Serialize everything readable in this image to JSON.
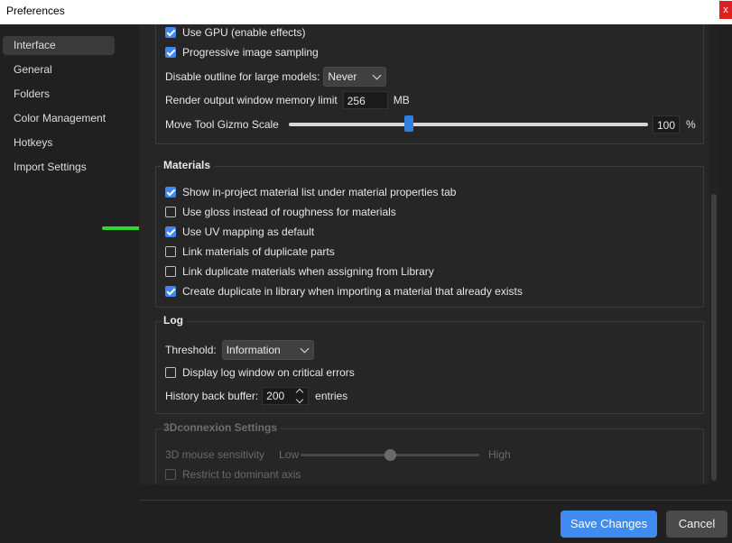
{
  "window": {
    "title": "Preferences",
    "close_glyph": "x"
  },
  "sidebar": {
    "items": [
      {
        "label": "Interface",
        "active": true
      },
      {
        "label": "General"
      },
      {
        "label": "Folders"
      },
      {
        "label": "Color Management"
      },
      {
        "label": "Hotkeys"
      },
      {
        "label": "Import Settings"
      }
    ]
  },
  "interface": {
    "use_gpu_label": "Use GPU (enable effects)",
    "progressive_label": "Progressive image sampling",
    "disable_outline_label": "Disable outline for large models:",
    "disable_outline_value": "Never",
    "render_memory_label": "Render output window memory limit",
    "render_memory_value": "256",
    "render_memory_unit": "MB",
    "gizmo_label": "Move Tool Gizmo Scale",
    "gizmo_value": "100",
    "gizmo_unit": "%",
    "gizmo_fraction": 0.335
  },
  "materials": {
    "title": "Materials",
    "options": [
      {
        "label": "Show in-project material list under material properties tab",
        "checked": true
      },
      {
        "label": "Use gloss instead of roughness for materials",
        "checked": false
      },
      {
        "label": "Use UV mapping as default",
        "checked": true
      },
      {
        "label": "Link materials of duplicate parts",
        "checked": false
      },
      {
        "label": "Link duplicate materials when assigning from Library",
        "checked": false
      },
      {
        "label": "Create duplicate in library when importing a material that already exists",
        "checked": true
      }
    ]
  },
  "log": {
    "title": "Log",
    "threshold_label": "Threshold:",
    "threshold_value": "Information",
    "display_window_label": "Display log window on critical errors",
    "history_label": "History back buffer:",
    "history_value": "200",
    "history_unit": "entries"
  },
  "connexion": {
    "title": "3Dconnexion Settings",
    "sensitivity_label": "3D mouse sensitivity",
    "low_label": "Low",
    "high_label": "High",
    "sensitivity_fraction": 0.5,
    "restrict_label": "Restrict to dominant axis"
  },
  "footer": {
    "save_label": "Save Changes",
    "cancel_label": "Cancel"
  },
  "colors": {
    "accent": "#3f8bf0",
    "arrow": "#2bd92b"
  }
}
